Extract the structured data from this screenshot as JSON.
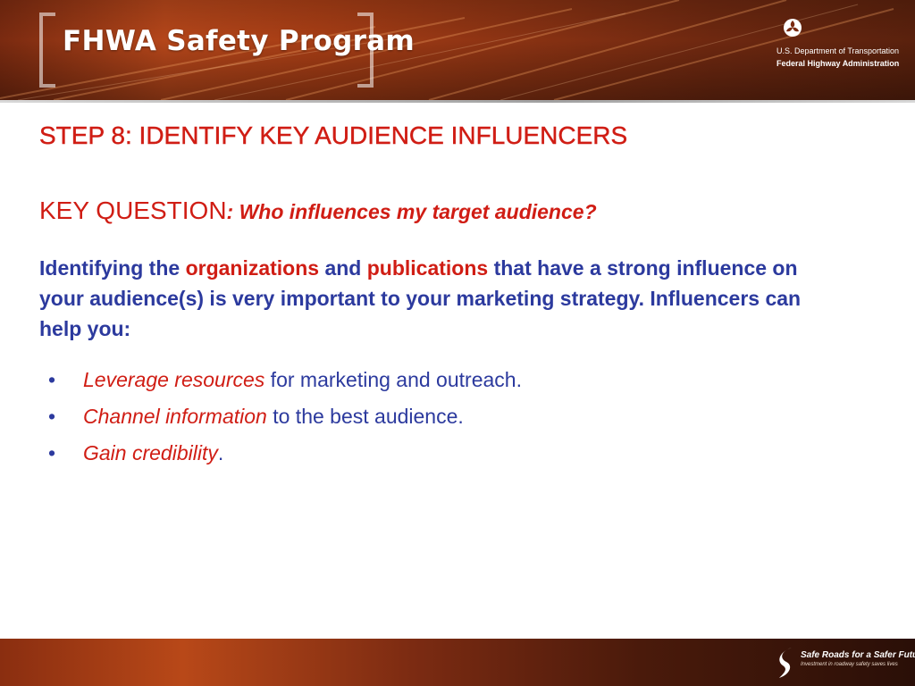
{
  "header": {
    "program_title": "FHWA Safety Program",
    "agency": {
      "department": "U.S. Department of Transportation",
      "name": "Federal Highway Administration",
      "logo_icon": "dot-triskelion-icon"
    }
  },
  "slide": {
    "step_title": "STEP 8: IDENTIFY KEY AUDIENCE INFLUENCERS",
    "key_question": {
      "label": "KEY QUESTION",
      "text": ": Who influences my target audience?"
    },
    "intro": {
      "part1": "Identifying the ",
      "highlight1": "organizations",
      "part2": " and ",
      "highlight2": "publications",
      "part3": " that have a strong influence on your audience(s) is very important to your marketing strategy. Influencers can help you:"
    },
    "bullets": [
      {
        "marker": "•",
        "emphasis": "Leverage resources",
        "rest": " for marketing and outreach."
      },
      {
        "marker": "•",
        "emphasis": "Channel information",
        "rest": " to the best audience."
      },
      {
        "marker": "•",
        "emphasis": "Gain credibility",
        "rest": "."
      }
    ]
  },
  "footer": {
    "logo_icon": "safe-roads-swoosh-icon",
    "tagline": "Safe Roads for a Safer Future",
    "subtagline": "Investment in roadway safety saves lives"
  },
  "colors": {
    "title_red": "#d01d14",
    "body_blue": "#2c3a9e",
    "banner_orange": "#b5461a",
    "footer_dark": "#2a0f07"
  }
}
